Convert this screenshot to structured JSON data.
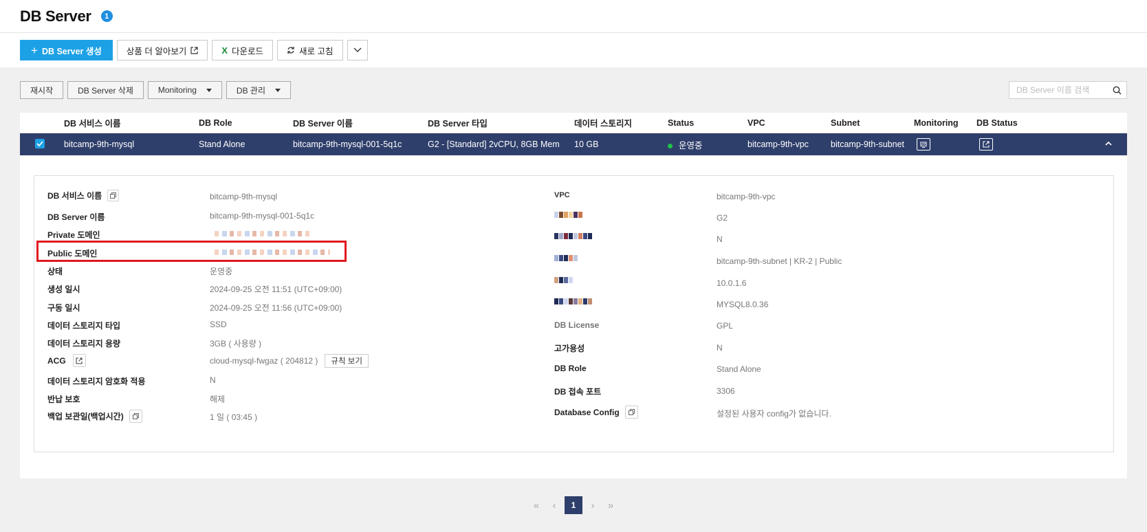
{
  "header": {
    "title": "DB Server",
    "badge": "1"
  },
  "toolbar": {
    "create_label": "DB Server 생성",
    "learn_more_label": "상품 더 알아보기",
    "download_label": "다운로드",
    "refresh_label": "새로 고침"
  },
  "filters": {
    "restart_label": "재시작",
    "delete_label": "DB Server 삭제",
    "monitoring_label": "Monitoring",
    "db_manage_label": "DB 관리",
    "search_placeholder": "DB Server 이름 검색"
  },
  "table": {
    "headers": [
      "DB 서비스 이름",
      "DB Role",
      "DB Server 이름",
      "DB Server 타입",
      "데이터 스토리지",
      "Status",
      "VPC",
      "Subnet",
      "Monitoring",
      "DB Status"
    ],
    "row": {
      "service_name": "bitcamp-9th-mysql",
      "role": "Stand Alone",
      "server_name": "bitcamp-9th-mysql-001-5q1c",
      "server_type": "G2 - [Standard] 2vCPU, 8GB Mem",
      "storage": "10 GB",
      "status": "운영중",
      "vpc": "bitcamp-9th-vpc",
      "subnet": "bitcamp-9th-subnet"
    }
  },
  "detail": {
    "left": [
      {
        "label": "DB 서비스 이름",
        "value": "bitcamp-9th-mysql"
      },
      {
        "label": "DB Server 이름",
        "value": "bitcamp-9th-mysql-001-5q1c"
      },
      {
        "label": "Private 도메인",
        "value": ""
      },
      {
        "label": "Public 도메인",
        "value": ""
      },
      {
        "label": "상태",
        "value": "운영중"
      },
      {
        "label": "생성 일시",
        "value": "2024-09-25 오전 11:51 (UTC+09:00)"
      },
      {
        "label": "구동 일시",
        "value": "2024-09-25 오전 11:56 (UTC+09:00)"
      },
      {
        "label": "데이터 스토리지 타입",
        "value": "SSD"
      },
      {
        "label": "데이터 스토리지 용량",
        "value": "3GB ( 사용량 )"
      },
      {
        "label": "ACG",
        "value": "cloud-mysql-fwgaz ( 204812 )"
      },
      {
        "label": "데이터 스토리지 암호화 적용",
        "value": "N"
      },
      {
        "label": "반납 보호",
        "value": "해제"
      },
      {
        "label": "백업 보관일(백업시간)",
        "value": "1 일 ( 03:45 )"
      }
    ],
    "rule_view_label": "규칙 보기",
    "right": [
      {
        "label": "VPC",
        "value": "bitcamp-9th-vpc"
      },
      {
        "label": "",
        "value": "G2"
      },
      {
        "label": "",
        "value": "N"
      },
      {
        "label": "",
        "value": "bitcamp-9th-subnet | KR-2 | Public"
      },
      {
        "label": "",
        "value": "10.0.1.6"
      },
      {
        "label": "",
        "value": "MYSQL8.0.36"
      },
      {
        "label": "DB License",
        "value": "GPL"
      },
      {
        "label": "고가용성",
        "value": "N"
      },
      {
        "label": "DB Role",
        "value": "Stand Alone"
      },
      {
        "label": "DB 접속 포트",
        "value": "3306"
      },
      {
        "label": "Database Config",
        "value": "설정된 사용자 config가 없습니다."
      }
    ]
  },
  "pagination": {
    "current": "1"
  },
  "colors": {
    "accent": "#1da1e6",
    "selected_row": "#2f3f6b",
    "status_green": "#1ec24b",
    "highlight": "#e0181f"
  }
}
